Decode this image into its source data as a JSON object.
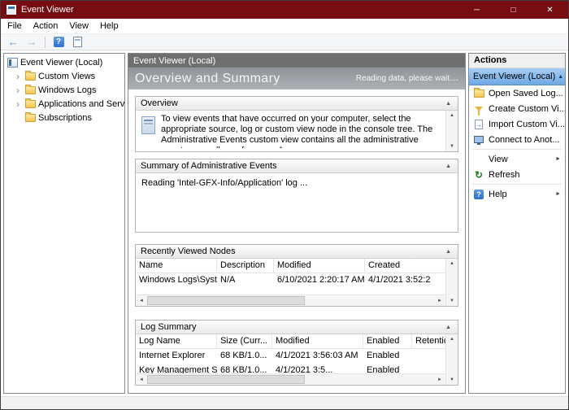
{
  "titlebar": {
    "title": "Event Viewer"
  },
  "window_controls": {
    "minimize": "─",
    "maximize": "□",
    "close": "✕"
  },
  "menu": {
    "items": [
      "File",
      "Action",
      "View",
      "Help"
    ]
  },
  "icons": {
    "back": "←",
    "forward": "→",
    "help": "?",
    "collapse": "▲",
    "submenu": "►",
    "scroll_up": "▲",
    "scroll_down": "▼",
    "scroll_left": "◄",
    "scroll_right": "►",
    "tree_chevron": "›",
    "refresh": "↻"
  },
  "tree": {
    "root": "Event Viewer (Local)",
    "items": [
      "Custom Views",
      "Windows Logs",
      "Applications and Services Lo",
      "Subscriptions"
    ]
  },
  "main": {
    "header": "Event Viewer (Local)",
    "banner_title": "Overview and Summary",
    "banner_status": "Reading data, please wait....",
    "overview": {
      "title": "Overview",
      "text": "To view events that have occurred on your computer, select the appropriate source, log or custom view node in the console tree. The Administrative Events custom view contains all the administrative events, regardless of source. An"
    },
    "admin_summary": {
      "title": "Summary of Administrative Events",
      "status": "Reading 'Intel-GFX-Info/Application' log ..."
    },
    "recent": {
      "title": "Recently Viewed Nodes",
      "columns": [
        "Name",
        "Description",
        "Modified",
        "Created"
      ],
      "rows": [
        [
          "Windows Logs\\System",
          "N/A",
          "6/10/2021 2:20:17 AM",
          "4/1/2021 3:52:2"
        ]
      ]
    },
    "log_summary": {
      "title": "Log Summary",
      "columns": [
        "Log Name",
        "Size (Curr...",
        "Modified",
        "Enabled",
        "Retention"
      ],
      "rows": [
        [
          "Internet Explorer",
          "68 KB/1.0...",
          "4/1/2021 3:56:03 AM",
          "Enabled",
          ""
        ],
        [
          "Key Management Servi",
          "68 KB/1.0...",
          "4/1/2021 3:5...",
          "Enabled",
          ""
        ]
      ]
    }
  },
  "actions": {
    "title": "Actions",
    "group": "Event Viewer (Local)",
    "items": [
      "Open Saved Log...",
      "Create Custom Vi...",
      "Import Custom Vi...",
      "Connect to Anot...",
      "View",
      "Refresh",
      "Help"
    ]
  }
}
